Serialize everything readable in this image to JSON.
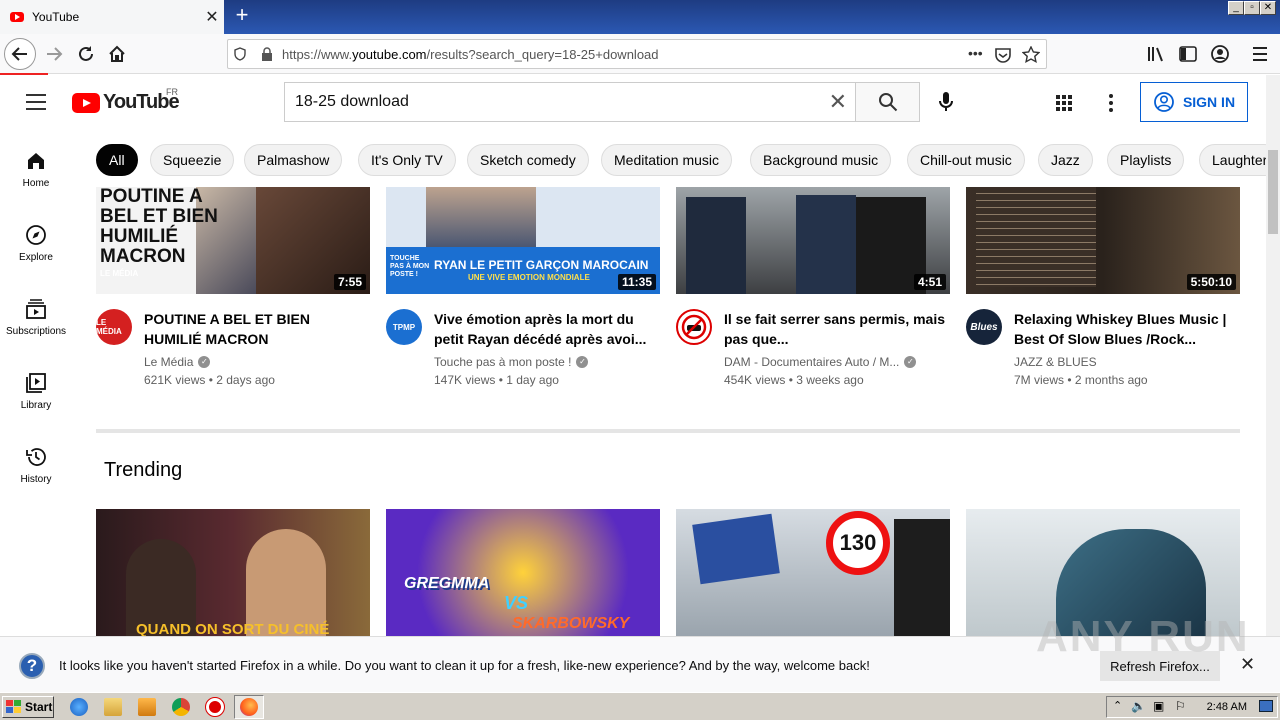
{
  "browser": {
    "tab_title": "YouTube",
    "tab_close": "✕",
    "new_tab": "+",
    "url_prefix": "https://www.",
    "url_domain": "youtube.com",
    "url_rest": "/results?search_query=18-25+download",
    "url_more": "•••"
  },
  "youtube": {
    "logo_text": "YouTube",
    "region": "FR",
    "search_value": "18-25 download",
    "sign_in": "SIGN IN"
  },
  "rail": [
    {
      "label": "Home"
    },
    {
      "label": "Explore"
    },
    {
      "label": "Subscriptions"
    },
    {
      "label": "Library"
    },
    {
      "label": "History"
    }
  ],
  "chips": [
    "All",
    "Squeezie",
    "Palmashow",
    "It's Only TV",
    "Sketch comedy",
    "Meditation music",
    "Background music",
    "Chill-out music",
    "Jazz",
    "Playlists",
    "Laughter"
  ],
  "videos": [
    {
      "thumb_text": "POUTINE A BEL ET BIEN HUMILIÉ MACRON",
      "thumb_brand": "LE MÉDIA",
      "duration": "7:55",
      "title": "POUTINE A BEL ET BIEN HUMILIÉ MACRON",
      "channel": "Le Média",
      "meta": "621K views • 2 days ago",
      "avatar_text": "LE MÉDIA"
    },
    {
      "thumb_text": "RYAN LE PETIT GARÇON MAROCAIN",
      "thumb_sub": "UNE VIVE EMOTION MONDIALE",
      "thumb_brand": "TOUCHE PAS À MON POSTE !",
      "duration": "11:35",
      "title": "Vive émotion après la mort du petit Rayan décédé après avoi...",
      "channel": "Touche pas à mon poste !",
      "meta": "147K views • 1 day ago",
      "avatar_text": "TPMP"
    },
    {
      "duration": "4:51",
      "title": "Il se fait serrer sans permis, mais pas que...",
      "channel": "DAM - Documentaires Auto / M...",
      "meta": "454K views • 3 weeks ago",
      "avatar_text": ""
    },
    {
      "duration": "5:50:10",
      "title": "Relaxing Whiskey Blues Music | Best Of Slow Blues /Rock...",
      "channel": "JAZZ & BLUES",
      "meta": "7M views • 2 months ago",
      "avatar_text": "Blues"
    }
  ],
  "trending": {
    "title": "Trending",
    "thumb2_top": "GREGMMA",
    "thumb2_vs": "VS",
    "thumb2_bottom": "SKARBOWSKY",
    "thumb3_sign": "130",
    "thumb1_caption": "QUAND ON SORT DU CINÉ"
  },
  "notification": {
    "icon": "?",
    "text": "It looks like you haven't started Firefox in a while. Do you want to clean it up for a fresh, like-new experience? And by the way, welcome back!",
    "button": "Refresh Firefox...",
    "close": "✕"
  },
  "watermark": "ANY RUN",
  "taskbar": {
    "start": "Start",
    "clock": "2:48 AM"
  }
}
